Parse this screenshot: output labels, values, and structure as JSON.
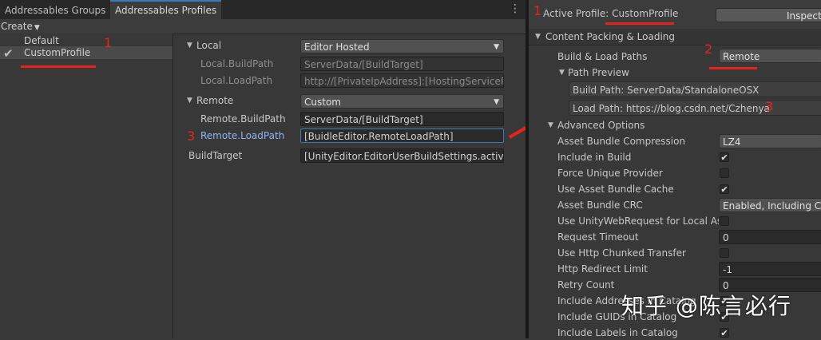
{
  "tabs": [
    {
      "label": "Addressables Groups"
    },
    {
      "label": "Addressables Profiles"
    }
  ],
  "toolbar": {
    "create_label": "Create",
    "more_icon": "⋮"
  },
  "profiles": [
    "Default",
    "CustomProfile"
  ],
  "annotations": {
    "n1": "1",
    "n2": "2",
    "n3": "3",
    "n1_inspector": "1"
  },
  "variables": {
    "local_label": "Local",
    "local_value": "Editor Hosted",
    "local_buildpath_label": "Local.BuildPath",
    "local_buildpath_value": "ServerData/[BuildTarget]",
    "local_loadpath_label": "Local.LoadPath",
    "local_loadpath_value": "http://[PrivateIpAddress]:[HostingServicePor",
    "remote_label": "Remote",
    "remote_value": "Custom",
    "remote_buildpath_label": "Remote.BuildPath",
    "remote_buildpath_value": "ServerData/[BuildTarget]",
    "remote_loadpath_label": "Remote.LoadPath",
    "remote_loadpath_value": "[BuidleEditor.RemoteLoadPath]",
    "buildtarget_label": "BuildTarget",
    "buildtarget_value": "[UnityEditor.EditorUserBuildSettings.activeBu"
  },
  "inspector": {
    "active_profile_label": "Active Profile: CustomProfile",
    "inspect_label": "Inspect",
    "section_label": "Content Packing & Loading",
    "build_load_label": "Build & Load Paths",
    "build_load_value": "Remote",
    "path_preview_label": "Path Preview",
    "build_path": "Build Path: ServerData/StandaloneOSX",
    "load_path": "Load Path: https://blog.csdn.net/Czhenya",
    "advanced_label": "Advanced Options",
    "rows": [
      {
        "label": "Asset Bundle Compression",
        "kind": "dropdown",
        "value": "LZ4"
      },
      {
        "label": "Include in Build",
        "kind": "toggle",
        "value": "✔"
      },
      {
        "label": "Force Unique Provider",
        "kind": "toggle",
        "value": ""
      },
      {
        "label": "Use Asset Bundle Cache",
        "kind": "toggle",
        "value": "✔"
      },
      {
        "label": "Asset Bundle CRC",
        "kind": "dropdown",
        "value": "Enabled, Including Cac"
      },
      {
        "label": "Use UnityWebRequest for Local Ass",
        "kind": "toggle",
        "value": ""
      },
      {
        "label": "Request Timeout",
        "kind": "field",
        "value": "0"
      },
      {
        "label": "Use Http Chunked Transfer",
        "kind": "toggle",
        "value": ""
      },
      {
        "label": "Http Redirect Limit",
        "kind": "field",
        "value": "-1"
      },
      {
        "label": "Retry Count",
        "kind": "field",
        "value": "0"
      },
      {
        "label": "Include Addresses in Catalog",
        "kind": "toggle",
        "value": "✔"
      },
      {
        "label": "Include GUIDs in Catalog",
        "kind": "toggle",
        "value": "✔"
      },
      {
        "label": "Include Labels in Catalog",
        "kind": "toggle",
        "value": "✔"
      }
    ]
  },
  "watermark": "知乎 @陈言必行",
  "colors": {
    "accent": "#3a79bb",
    "annotation_red": "#e8231d",
    "link_blue": "#8fb4f0"
  }
}
